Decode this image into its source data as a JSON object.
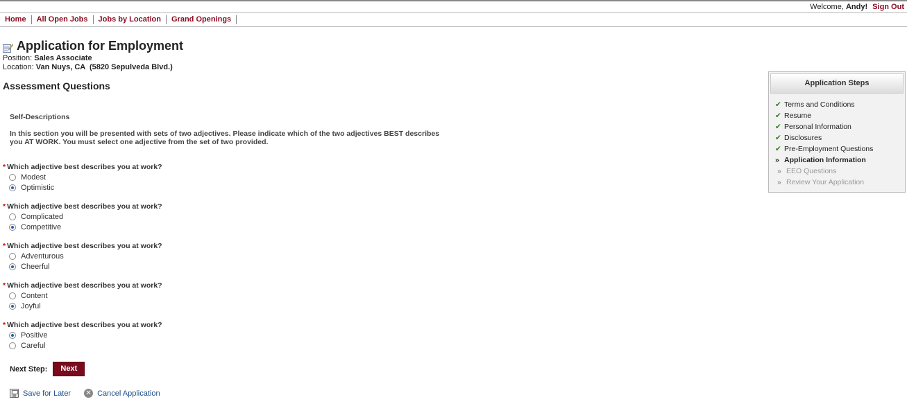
{
  "header": {
    "welcome": "Welcome,",
    "user": "Andy!",
    "sign_out": "Sign Out"
  },
  "nav": [
    "Home",
    "All Open Jobs",
    "Jobs by Location",
    "Grand Openings"
  ],
  "page": {
    "title": "Application for Employment",
    "position_label": "Position:",
    "position": "Sales Associate",
    "location_label": "Location:",
    "location": "Van Nuys, CA  (5820 Sepulveda Blvd.)",
    "section_title": "Assessment Questions",
    "subsection": "Self-Descriptions",
    "instructions": "In this section you will be presented with sets of two adjectives. Please indicate which of the two adjectives BEST describes you AT WORK. You must select one adjective from the set of two provided."
  },
  "questions": [
    {
      "label": "Which adjective best describes you at work?",
      "options": [
        "Modest",
        "Optimistic"
      ],
      "selected": 1
    },
    {
      "label": "Which adjective best describes you at work?",
      "options": [
        "Complicated",
        "Competitive"
      ],
      "selected": 1
    },
    {
      "label": "Which adjective best describes you at work?",
      "options": [
        "Adventurous",
        "Cheerful"
      ],
      "selected": 1
    },
    {
      "label": "Which adjective best describes you at work?",
      "options": [
        "Content",
        "Joyful"
      ],
      "selected": 1
    },
    {
      "label": "Which adjective best describes you at work?",
      "options": [
        "Positive",
        "Careful"
      ],
      "selected": 0
    }
  ],
  "required_marker": "*",
  "next_step": {
    "label": "Next Step:",
    "button": "Next"
  },
  "actions": {
    "save": "Save for Later",
    "cancel": "Cancel Application"
  },
  "steps_panel": {
    "title": "Application Steps",
    "steps": [
      {
        "label": "Terms and Conditions",
        "state": "done"
      },
      {
        "label": "Resume",
        "state": "done"
      },
      {
        "label": "Personal Information",
        "state": "done"
      },
      {
        "label": "Disclosures",
        "state": "done"
      },
      {
        "label": "Pre-Employment Questions",
        "state": "done"
      },
      {
        "label": "Application Information",
        "state": "current"
      },
      {
        "label": "EEO Questions",
        "state": "pending"
      },
      {
        "label": "Review Your Application",
        "state": "pending"
      }
    ]
  },
  "colors": {
    "brand": "#8b0a1e",
    "link": "#1a4a8a",
    "check": "#2e7d1e",
    "required": "#cc0000"
  }
}
